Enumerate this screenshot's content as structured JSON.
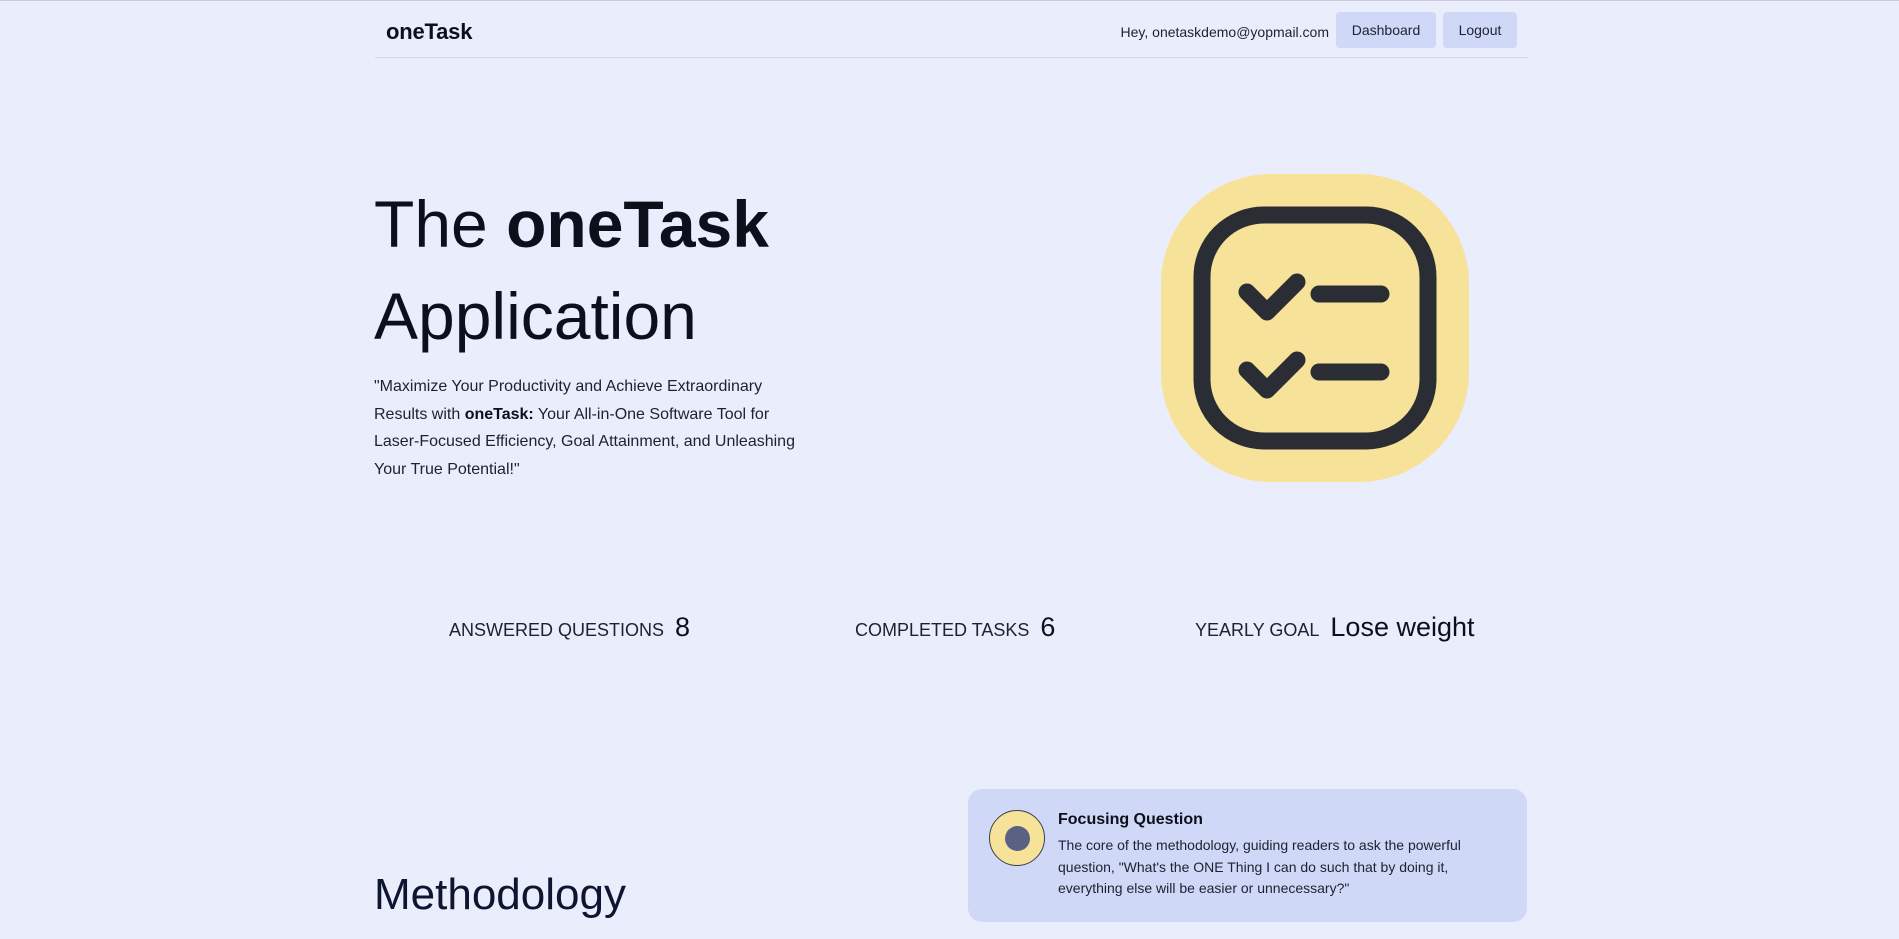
{
  "navbar": {
    "brand": "oneTask",
    "greeting": "Hey, onetaskdemo@yopmail.com",
    "dashboard_label": "Dashboard",
    "logout_label": "Logout"
  },
  "hero": {
    "title_prefix": "The ",
    "title_brand": "oneTask",
    "title_suffix": "Application",
    "desc_before": "\"Maximize Your Productivity and Achieve Extraordinary Results with ",
    "desc_brand": "oneTask:",
    "desc_after": " Your All-in-One Software Tool for Laser-Focused Efficiency, Goal Attainment, and Unleashing Your True Potential!\"",
    "icon": "checklist-icon"
  },
  "stats": [
    {
      "label": "Answered Questions",
      "value": "8"
    },
    {
      "label": "Completed Tasks",
      "value": "6"
    },
    {
      "label": "Yearly Goal",
      "value": "Lose weight"
    }
  ],
  "methodology": {
    "heading": "Methodology",
    "card": {
      "title": "Focusing Question",
      "text": "The core of the methodology, guiding readers to ask the powerful question, \"What's the ONE Thing I can do such that by doing it, everything else will be easier or unnecessary?\""
    }
  },
  "colors": {
    "background": "#eaedfb",
    "button": "#cfd8f7",
    "icon_fill": "#f7e29a",
    "icon_stroke": "#2b2d34",
    "card": "#cfd8f7"
  }
}
